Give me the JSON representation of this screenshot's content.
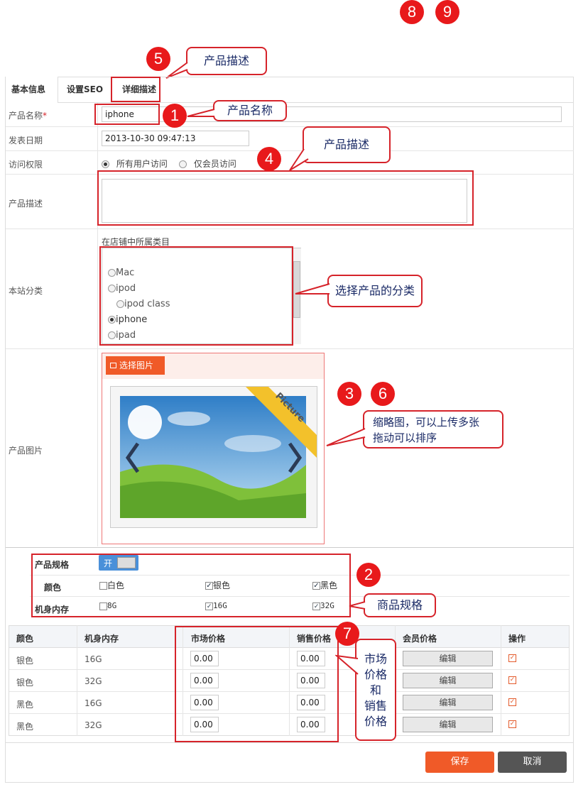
{
  "tabs": [
    {
      "label": "基本信息"
    },
    {
      "label": "设置SEO"
    },
    {
      "label": "详细描述"
    }
  ],
  "fields": {
    "name_label": "产品名称",
    "required_mark": "*",
    "name_value": "iphone",
    "date_label": "发表日期",
    "date_value": "2013-10-30 09:47:13",
    "access_label": "访问权限",
    "access_all": "所有用户访问",
    "access_member": "仅会员访问",
    "desc_label": "产品描述",
    "category_label": "本站分类",
    "category_hint": "在店铺中所属类目",
    "categories": [
      {
        "label": "Mac",
        "selected": false
      },
      {
        "label": "ipod",
        "selected": false
      },
      {
        "label": "ipod class",
        "selected": false
      },
      {
        "label": "iphone",
        "selected": true
      },
      {
        "label": "ipad",
        "selected": false
      }
    ],
    "image_label": "产品图片",
    "choose_image": "选择图片",
    "picture_ribbon": "Picture"
  },
  "specs": {
    "title": "产品规格",
    "toggle_label": "开",
    "color_label": "颜色",
    "colors": [
      {
        "label": "白色",
        "checked": false
      },
      {
        "label": "银色",
        "checked": true
      },
      {
        "label": "黑色",
        "checked": true
      }
    ],
    "memory_label": "机身内存",
    "memories": [
      {
        "label": "8G",
        "checked": false
      },
      {
        "label": "16G",
        "checked": true
      },
      {
        "label": "32G",
        "checked": true
      }
    ]
  },
  "sku_table": {
    "headers": [
      "颜色",
      "机身内存",
      "市场价格",
      "销售价格",
      "会员价格",
      "操作"
    ],
    "rows": [
      {
        "color": "银色",
        "memory": "16G",
        "market": "0.00",
        "sale": "0.00",
        "member": "编辑"
      },
      {
        "color": "银色",
        "memory": "32G",
        "market": "0.00",
        "sale": "0.00",
        "member": "编辑"
      },
      {
        "color": "黑色",
        "memory": "16G",
        "market": "0.00",
        "sale": "0.00",
        "member": "编辑"
      },
      {
        "color": "黑色",
        "memory": "32G",
        "market": "0.00",
        "sale": "0.00",
        "member": "编辑"
      }
    ]
  },
  "actions": {
    "save": "保存",
    "cancel": "取消"
  },
  "annotations": {
    "badges": [
      "8",
      "9",
      "5",
      "1",
      "4",
      "3",
      "6",
      "2",
      "7"
    ],
    "callout_tab": "产品描述",
    "callout_name": "产品名称",
    "callout_desc": "产品描述",
    "callout_category": "选择产品的分类",
    "callout_thumb_1": "缩略图，可以上传多张",
    "callout_thumb_2": "拖动可以排序",
    "callout_spec": "商品规格",
    "callout_price": [
      "市场",
      "价格",
      "和",
      "销售",
      "价格"
    ]
  },
  "colors": {
    "accent_red": "#d6232a",
    "save_button": "#f05a28",
    "cancel_button": "#555555",
    "toggle_blue": "#4a90d9"
  }
}
